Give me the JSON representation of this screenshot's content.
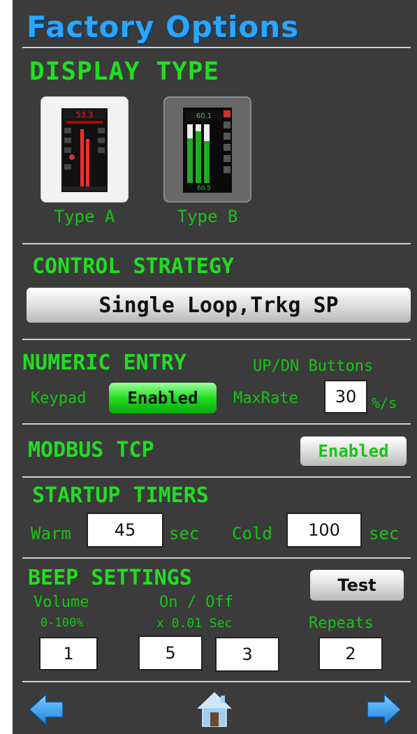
{
  "page": {
    "title": "Factory Options"
  },
  "display_type": {
    "heading": "DISPLAY TYPE",
    "options": [
      {
        "label": "Type A",
        "screen_value": "53.3"
      },
      {
        "label": "Type B",
        "screen_value": "60.1",
        "screen_value2": "60.5"
      }
    ],
    "selected": "Type B"
  },
  "control_strategy": {
    "heading": "CONTROL STRATEGY",
    "value": "Single Loop,Trkg SP"
  },
  "numeric_entry": {
    "heading": "NUMERIC ENTRY",
    "updn_label": "UP/DN Buttons",
    "keypad_label": "Keypad",
    "keypad_state": "Enabled",
    "maxrate_label": "MaxRate",
    "maxrate_value": "30",
    "maxrate_unit": "%/s"
  },
  "modbus": {
    "heading": "MODBUS TCP",
    "state": "Enabled"
  },
  "startup_timers": {
    "heading": "STARTUP TIMERS",
    "warm_label": "Warm",
    "warm_value": "45",
    "warm_unit": "sec",
    "cold_label": "Cold",
    "cold_value": "100",
    "cold_unit": "sec"
  },
  "beep_settings": {
    "heading": "BEEP SETTINGS",
    "test_label": "Test",
    "volume_label": "Volume",
    "volume_range": "0-100%",
    "onoff_label": "On / Off",
    "onoff_unit": "x 0.01 Sec",
    "repeats_label": "Repeats",
    "volume_value": "1",
    "on_value": "5",
    "off_value": "3",
    "repeats_value": "2"
  },
  "nav": {
    "back": "arrow-left-icon",
    "home": "home-icon",
    "forward": "arrow-right-icon"
  },
  "colors": {
    "background": "#3b3b3b",
    "green": "#22dd22",
    "title": "#2aa6ff",
    "arrow": "#2a8fe8"
  }
}
